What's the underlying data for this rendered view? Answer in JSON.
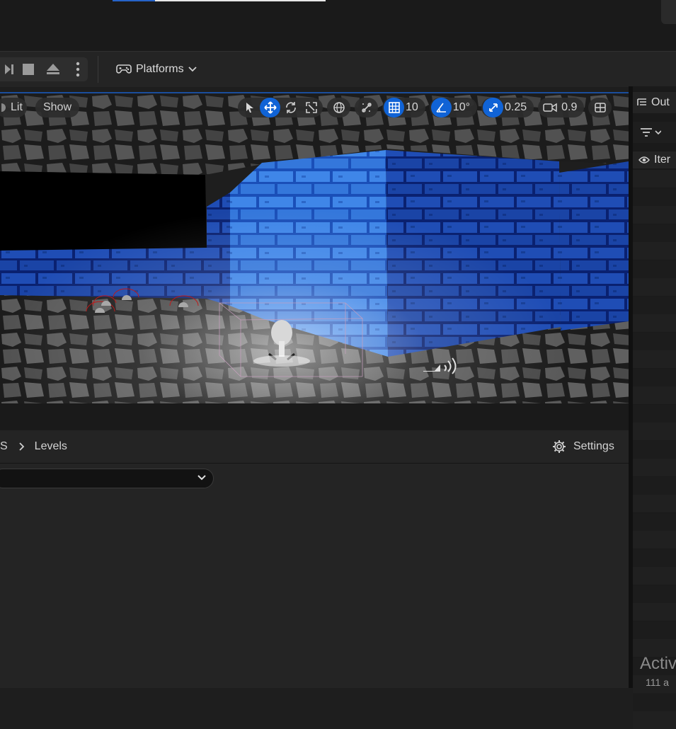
{
  "top": {
    "progress_fraction": 0.2
  },
  "toolbar": {
    "platforms_label": "Platforms"
  },
  "viewport": {
    "lit_label": "Lit",
    "show_label": "Show",
    "grid_snap": "10",
    "rotation_snap": "10°",
    "scale_snap": "0.25",
    "camera_speed": "0.9"
  },
  "content_browser": {
    "breadcrumb_partial": "S",
    "breadcrumb_levels": "Levels",
    "settings_label": "Settings"
  },
  "outliner": {
    "title_partial": "Out",
    "item_partial": "Iter"
  },
  "watermark": {
    "line1": "Activ",
    "line2": "111 a"
  },
  "colors": {
    "accent": "#1063d6",
    "brick": "#1f4db5"
  }
}
